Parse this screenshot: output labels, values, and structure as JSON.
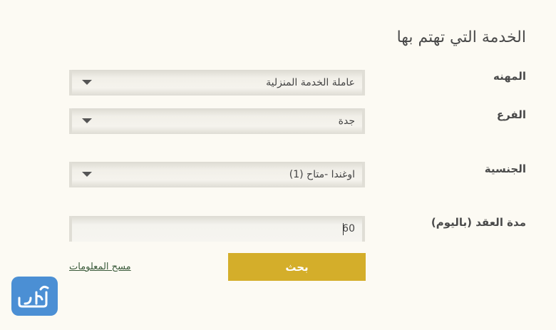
{
  "form": {
    "title": "الخدمة التي تهتم بها",
    "profession": {
      "label": "المهنه",
      "value": "عاملة الخدمة المنزلية"
    },
    "branch": {
      "label": "الفرع",
      "value": "جدة"
    },
    "nationality": {
      "label": "الجنسية",
      "value": "اوغندا -متاح (1)"
    },
    "contract": {
      "label": "مدة العقد (باليوم)",
      "value": "60"
    },
    "search_label": "بحث",
    "clear_label": "مسح المعلومات"
  },
  "logo": {
    "text": "المرجع",
    "color": "#4b8fd4"
  },
  "colors": {
    "accent": "#d4ae2a",
    "background": "#fcfaf3"
  }
}
